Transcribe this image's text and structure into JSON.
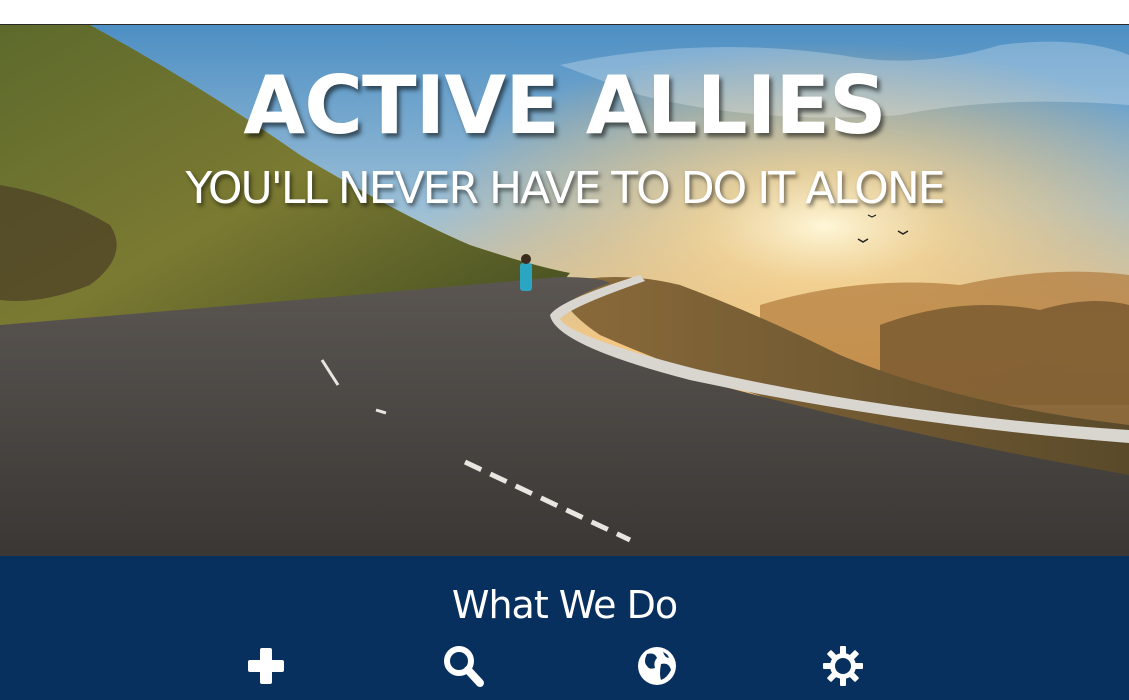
{
  "hero": {
    "title": "ACTIVE ALLIES",
    "subtitle": "YOU'LL NEVER HAVE TO DO IT ALONE"
  },
  "what_we_do": {
    "heading": "What We Do",
    "icons": [
      "plus-icon",
      "search-icon",
      "globe-icon",
      "gear-icon"
    ]
  },
  "colors": {
    "band_background": "#08305e",
    "text": "#ffffff"
  }
}
